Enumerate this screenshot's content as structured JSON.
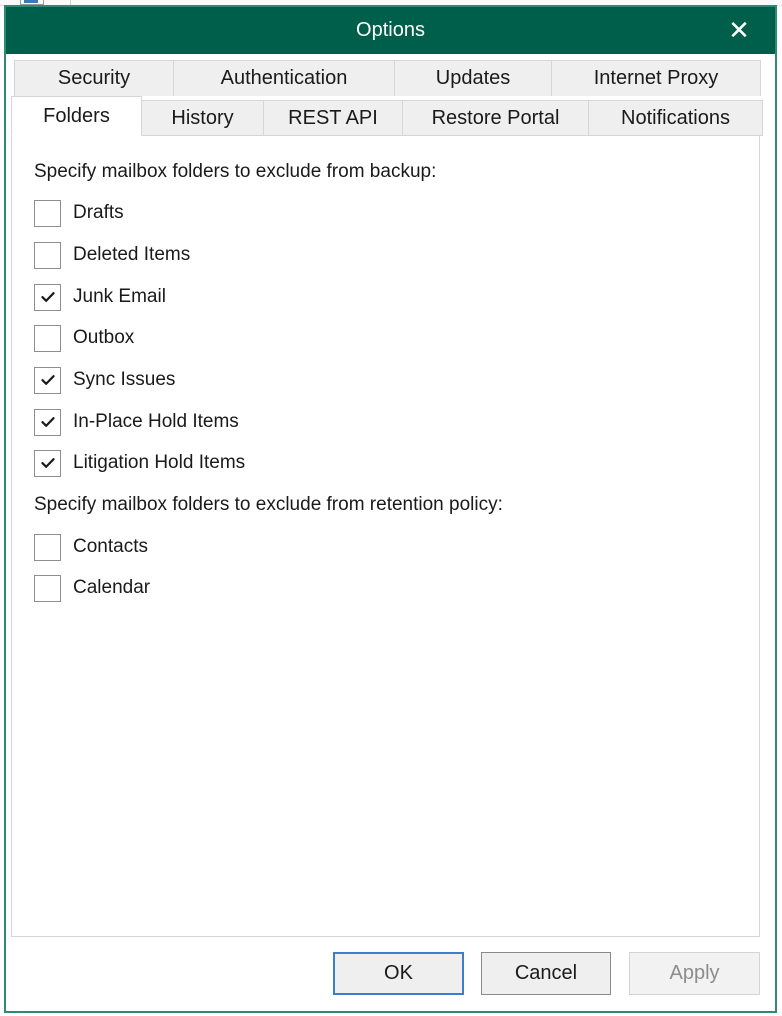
{
  "window": {
    "title": "Options",
    "close_icon": "close-icon"
  },
  "tabs": {
    "back_row": [
      {
        "label": "Security"
      },
      {
        "label": "Authentication"
      },
      {
        "label": "Updates"
      },
      {
        "label": "Internet Proxy"
      }
    ],
    "front_row": [
      {
        "label": "Folders",
        "active": true
      },
      {
        "label": "History",
        "active": false
      },
      {
        "label": "REST API",
        "active": false
      },
      {
        "label": "Restore Portal",
        "active": false
      },
      {
        "label": "Notifications",
        "active": false
      }
    ]
  },
  "backup_section": {
    "label": "Specify mailbox folders to exclude from backup:",
    "items": [
      {
        "label": "Drafts",
        "checked": false
      },
      {
        "label": "Deleted Items",
        "checked": false
      },
      {
        "label": "Junk Email",
        "checked": true
      },
      {
        "label": "Outbox",
        "checked": false
      },
      {
        "label": "Sync Issues",
        "checked": true
      },
      {
        "label": "In-Place Hold Items",
        "checked": true
      },
      {
        "label": "Litigation Hold Items",
        "checked": true
      }
    ]
  },
  "retention_section": {
    "label": "Specify mailbox folders to exclude from retention policy:",
    "items": [
      {
        "label": "Contacts",
        "checked": false
      },
      {
        "label": "Calendar",
        "checked": false
      }
    ]
  },
  "buttons": {
    "ok": "OK",
    "cancel": "Cancel",
    "apply": "Apply",
    "apply_enabled": false
  },
  "colors": {
    "titlebar": "#005f4b",
    "frame": "#2f8a74",
    "default_button_border": "#3a7fc9"
  }
}
